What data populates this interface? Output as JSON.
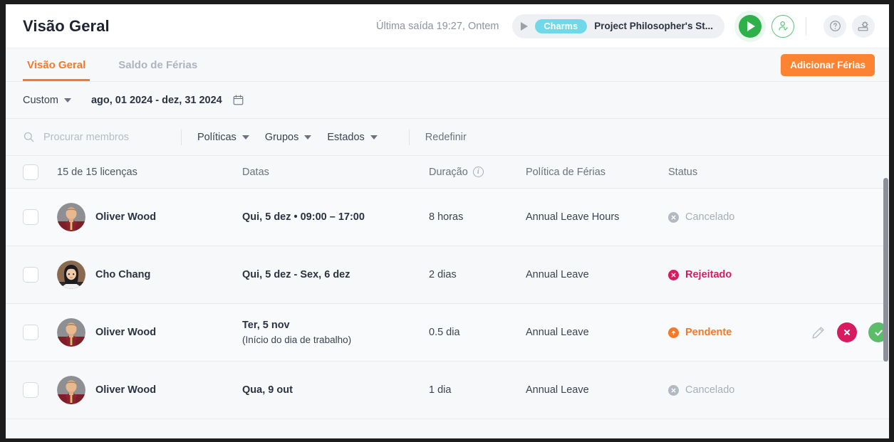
{
  "header": {
    "title": "Visão Geral",
    "last_out": "Última saída 19:27, Ontem",
    "timer": {
      "tag": "Charms",
      "task": "Project Philosopher's St...",
      "play_icon": "play-icon",
      "start_icon": "play-circle-icon",
      "user_icon": "user-check-icon"
    },
    "help_icon": "question-circle-icon",
    "settings_icon": "gear-settings-icon"
  },
  "tabs": {
    "items": [
      {
        "label": "Visão Geral",
        "active": true
      },
      {
        "label": "Saldo de Férias",
        "active": false
      }
    ],
    "add_button": "Adicionar Férias"
  },
  "date_filter": {
    "preset": "Custom",
    "range": "ago, 01 2024 - dez, 31 2024",
    "calendar_icon": "calendar-icon"
  },
  "filters": {
    "search_placeholder": "Procurar membros",
    "search_value": "",
    "search_icon": "search-icon",
    "dropdowns": [
      "Políticas",
      "Grupos",
      "Estados"
    ],
    "reset": "Redefinir"
  },
  "table": {
    "headers": {
      "licenses": "15 de 15 licenças",
      "dates": "Datas",
      "duration": "Duração",
      "policy": "Política de Férias",
      "status": "Status"
    },
    "rows": [
      {
        "name": "Oliver Wood",
        "avatar": "oliver-wood-avatar",
        "dates": "Qui, 5 dez • 09:00 – 17:00",
        "dates_sub": "",
        "duration": "8 horas",
        "policy": "Annual Leave Hours",
        "status": "Cancelado",
        "status_kind": "cancelado",
        "status_icon": "x-circle-icon",
        "actions": false
      },
      {
        "name": "Cho Chang",
        "avatar": "cho-chang-avatar",
        "dates": "Qui, 5 dez - Sex, 6 dez",
        "dates_sub": "",
        "duration": "2 dias",
        "policy": "Annual Leave",
        "status": "Rejeitado",
        "status_kind": "rejeitado",
        "status_icon": "x-circle-icon",
        "actions": false
      },
      {
        "name": "Oliver Wood",
        "avatar": "oliver-wood-avatar",
        "dates": "Ter, 5 nov",
        "dates_sub": "(Início do dia de trabalho)",
        "duration": "0.5 dia",
        "policy": "Annual Leave",
        "status": "Pendente",
        "status_kind": "pendente",
        "status_icon": "arrow-up-circle-icon",
        "actions": true,
        "action_icons": [
          "edit-pencil-icon",
          "reject-x-icon",
          "approve-check-icon"
        ]
      },
      {
        "name": "Oliver Wood",
        "avatar": "oliver-wood-avatar",
        "dates": "Qua, 9 out",
        "dates_sub": "",
        "duration": "1 dia",
        "policy": "Annual Leave",
        "status": "Cancelado",
        "status_kind": "cancelado",
        "status_icon": "x-circle-icon",
        "actions": false
      }
    ]
  },
  "colors": {
    "accent_orange": "#f4792b",
    "button_orange": "#fb8332",
    "reject_pink": "#d81b60",
    "approve_green": "#5bbd6a",
    "play_green": "#2fb04a",
    "tag_cyan": "#6fd9ea",
    "muted_gray": "#a8aeb7"
  }
}
